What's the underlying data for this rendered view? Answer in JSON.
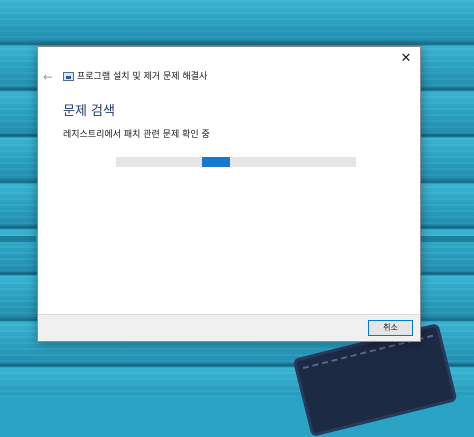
{
  "window": {
    "title": "프로그램 설치 및 제거 문제 해결사",
    "back_icon": "arrow-left-icon",
    "close_glyph": "✕",
    "back_glyph": "←"
  },
  "main": {
    "heading": "문제 검색",
    "status": "레지스트리에서 패치 관련 문제 확인 중",
    "progress": {
      "style": "marquee",
      "chunk_start_fraction": 0.36,
      "chunk_width_fraction": 0.115
    }
  },
  "footer": {
    "cancel_label": "취소"
  },
  "colors": {
    "accent": "#1479d0",
    "heading": "#1f3b74",
    "wallpaper": "#2aa3c4"
  }
}
